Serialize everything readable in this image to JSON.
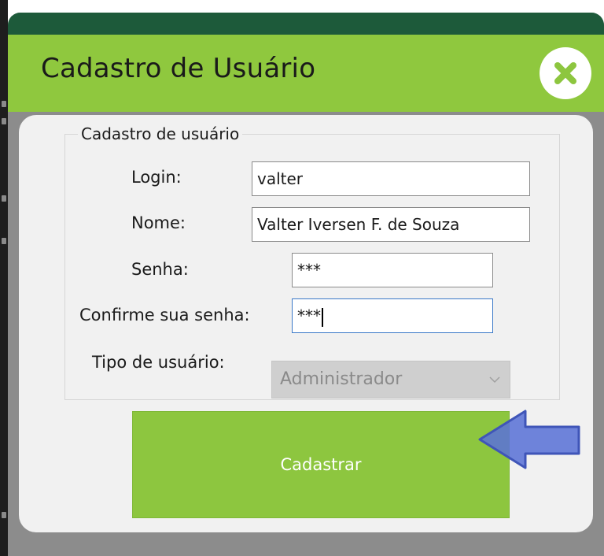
{
  "window": {
    "title": "Cadastro de Usuário"
  },
  "form": {
    "group_title": "Cadastro de usuário",
    "login": {
      "label": "Login:",
      "value": "valter"
    },
    "nome": {
      "label": "Nome:",
      "value": "Valter Iversen F. de Souza"
    },
    "senha": {
      "label": "Senha:",
      "value": "***"
    },
    "confirmar_senha": {
      "label": "Confirme sua senha:",
      "value": "***"
    },
    "tipo_usuario": {
      "label": "Tipo de usuário:",
      "selected": "Administrador"
    },
    "submit_label": "Cadastrar"
  },
  "icons": {
    "close": "close-icon",
    "dropdown": "chevron-down-icon",
    "pointer": "arrow-left-icon"
  },
  "colors": {
    "accent_green": "#8dc63f",
    "titlebar_green": "#8fc83e",
    "dark_rim": "#1d5a3a",
    "frame_gray": "#8c8c8c",
    "panel": "#f1f1f1",
    "arrow_blue": "#5b73d6"
  }
}
